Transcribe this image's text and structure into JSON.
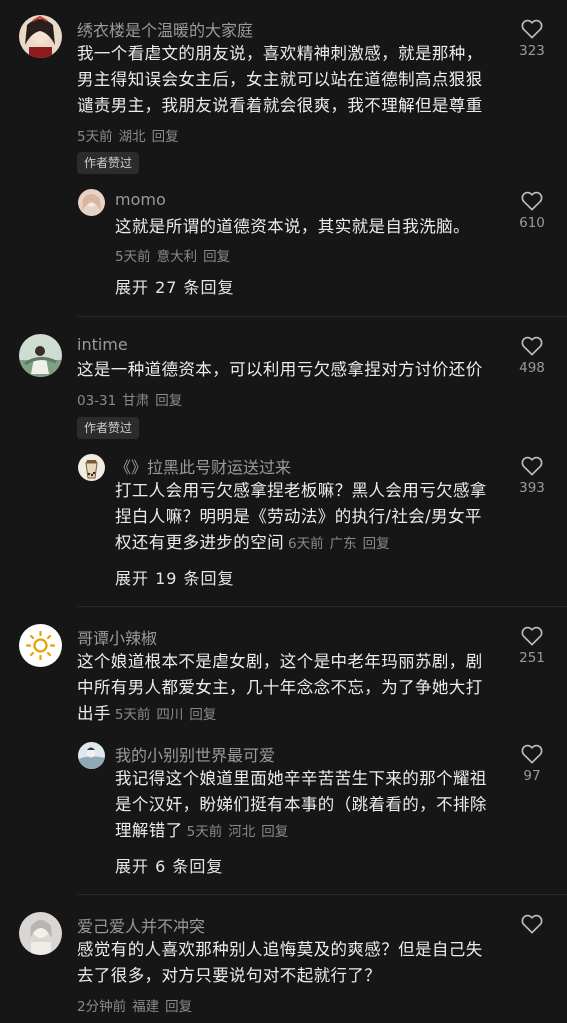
{
  "comments": [
    {
      "name": "绣衣楼是个温暖的大家庭",
      "lines": [
        "我一个看虐文的朋友说，喜欢精神刺激感，就是那种，",
        "男主得知误会女主后，女主就可以站在道德制高点狠狠",
        "谴责男主，我朋友说看着就会很爽，我不理解但是尊重"
      ],
      "time": "5天前",
      "location": "湖北",
      "reply": "回复",
      "badge": "作者赞过",
      "likes": "323",
      "sub": {
        "name": "momo",
        "lines": [
          "这就是所谓的道德资本说，其实就是自我洗脑。"
        ],
        "time": "5天前",
        "location": "意大利",
        "reply": "回复",
        "likes": "610"
      },
      "expand": "展开 27 条回复"
    },
    {
      "name": "intime",
      "lines": [
        "这是一种道德资本，可以利用亏欠感拿捏对方讨价还价"
      ],
      "time": "03-31",
      "location": "甘肃",
      "reply": "回复",
      "badge": "作者赞过",
      "likes": "498",
      "sub": {
        "name": "《》拉黑此号财运送过来",
        "lines": [
          "打工人会用亏欠感拿捏老板嘛？黑人会用亏欠感拿",
          "捏白人嘛？明明是《劳动法》的执行/社会/男女平",
          "权还有更多进步的空间"
        ],
        "time": "6天前",
        "location": "广东",
        "reply": "回复",
        "likes": "393"
      },
      "expand": "展开 19 条回复"
    },
    {
      "name": "哥谭小辣椒",
      "lines": [
        "这个娘道根本不是虐女剧，这个是中老年玛丽苏剧，剧",
        "中所有男人都爱女主，几十年念念不忘，为了争她大打",
        "出手"
      ],
      "time": "5天前",
      "location": "四川",
      "reply": "回复",
      "likes": "251",
      "sub": {
        "name": "我的小别别世界最可爱",
        "lines": [
          "我记得这个娘道里面她辛辛苦苦生下来的那个耀祖",
          "是个汉奸，盼娣们挺有本事的（跳着看的，不排除",
          "理解错了"
        ],
        "time": "5天前",
        "location": "河北",
        "reply": "回复",
        "likes": "97"
      },
      "expand": "展开 6 条回复"
    },
    {
      "name": "爱己爱人并不冲突",
      "lines": [
        "感觉有的人喜欢那种别人追悔莫及的爽感？但是自己失",
        "去了很多，对方只要说句对不起就行了？"
      ],
      "time": "2分钟前",
      "location": "福建",
      "reply": "回复",
      "likes": ""
    }
  ],
  "icons": {
    "like": "heart-outline-icon"
  },
  "colors": {
    "background": "#161616",
    "text": "#ececec",
    "muted": "#8a8a8a"
  }
}
